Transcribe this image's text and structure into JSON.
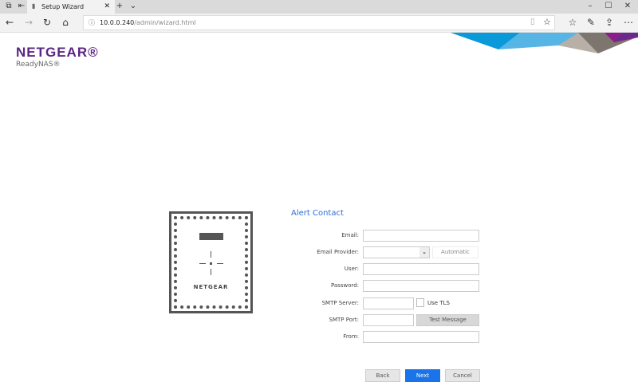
{
  "browser": {
    "tab_title": "Setup Wizard",
    "url_host": "10.0.0.240",
    "url_path": "/admin/wizard.html"
  },
  "brand": {
    "name": "NETGEAR®",
    "product": "ReadyNAS®",
    "device_label": "NETGEAR"
  },
  "form": {
    "title": "Alert Contact",
    "email_label": "Email:",
    "email_value": "",
    "provider_label": "Email Provider:",
    "provider_value": "",
    "automatic_label": "Automatic",
    "user_label": "User:",
    "user_value": "",
    "password_label": "Password:",
    "password_value": "",
    "smtp_server_label": "SMTP Server:",
    "smtp_server_value": "",
    "use_tls_label": "Use TLS",
    "use_tls_checked": false,
    "smtp_port_label": "SMTP Port:",
    "smtp_port_value": "",
    "test_message_label": "Test Message",
    "from_label": "From:",
    "from_value": ""
  },
  "buttons": {
    "back": "Back",
    "next": "Next",
    "cancel": "Cancel"
  },
  "colors": {
    "accent": "#1a73e8",
    "brand": "#5c2483"
  }
}
